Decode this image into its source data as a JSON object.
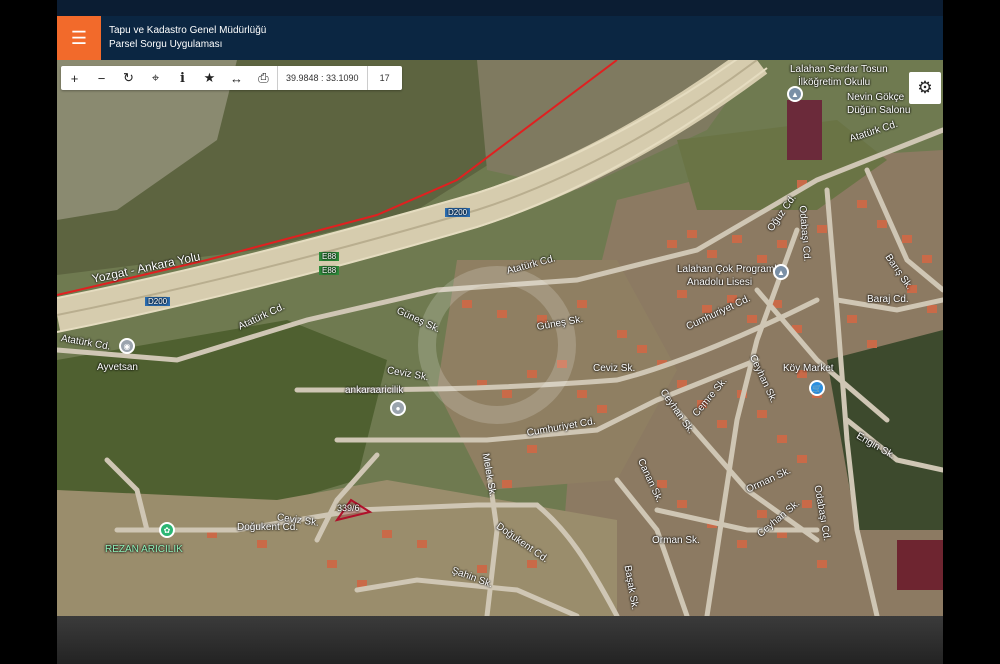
{
  "header": {
    "title_line1": "Tapu ve Kadastro Genel Müdürlüğü",
    "title_line2": "Parsel Sorgu Uygulaması",
    "menu_icon": "hamburger-icon",
    "accent": "#f26a2b",
    "bg": "#0b2642"
  },
  "toolbar": {
    "zoom_in": "+",
    "zoom_out": "−",
    "refresh": "↻",
    "locate": "⌖",
    "info": "i",
    "favorite": "★",
    "measure": "↔",
    "print": "⎙",
    "coordinates": "39.9848 : 33.1090",
    "zoom_level": "17"
  },
  "settings_icon": "⚙",
  "map": {
    "parcel_label": "339/6",
    "streets": {
      "yozgat": "Yozgat - Ankara Yolu",
      "d200a": "D200",
      "d200b": "D200",
      "e88": "E88",
      "e88b": "E88",
      "ataturk1": "Atatürk Cd.",
      "ataturk2": "Atatürk Cd.",
      "ataturk3": "Atatürk Cd.",
      "ataturk4": "Atatürk Cd.",
      "gunes1": "Güneş Sk.",
      "gunes2": "Güneş Sk.",
      "ceviz1": "Ceviz Sk.",
      "ceviz2": "Ceviz Sk.",
      "ceviz3": "Ceviz Sk.",
      "cumhuriyet1": "Cumhuriyet Cd.",
      "cumhuriyet2": "Cumhuriyet Cd.",
      "dogukent1": "Doğukent Cd.",
      "dogukent2": "Doğukent Cd.",
      "melek": "Melek Sk.",
      "sahin": "Şahin Sk.",
      "canan": "Canan Sk.",
      "ceyhan1": "Ceyhan Sk.",
      "ceyhan2": "Ceyhan Sk.",
      "ceyhan3": "Ceyhan Sk.",
      "cemre": "Cemre Sk.",
      "orman1": "Orman Sk.",
      "orman2": "Orman Sk.",
      "basak": "Başak Sk.",
      "odabasi1": "Odabaşı Cd.",
      "odabasi2": "Odabaşı Cd.",
      "oguz": "Oğuz Cd.",
      "baris": "Barış Sk.",
      "baraj": "Baraj Cd.",
      "engin": "Engin Sk."
    },
    "places": {
      "school1": "Lalahan Serdar Tosun",
      "school1b": "İlköğretim Okulu",
      "nevin": "Nevin Gökçe",
      "nevinb": "Düğün Salonu",
      "lise": "Lalahan Çok Programlı",
      "liseb": "Anadolu Lisesi",
      "ayvetsan": "Ayvetsan",
      "ankaraaricilik": "ankaraaricilik",
      "rezan": "REZAN ARICILIK",
      "koy_market": "Köy Market"
    },
    "poi_colors": {
      "school": "#7a8fa6",
      "place": "#9aa3ad",
      "market": "#2a8fe0",
      "green": "#2bb673"
    }
  }
}
